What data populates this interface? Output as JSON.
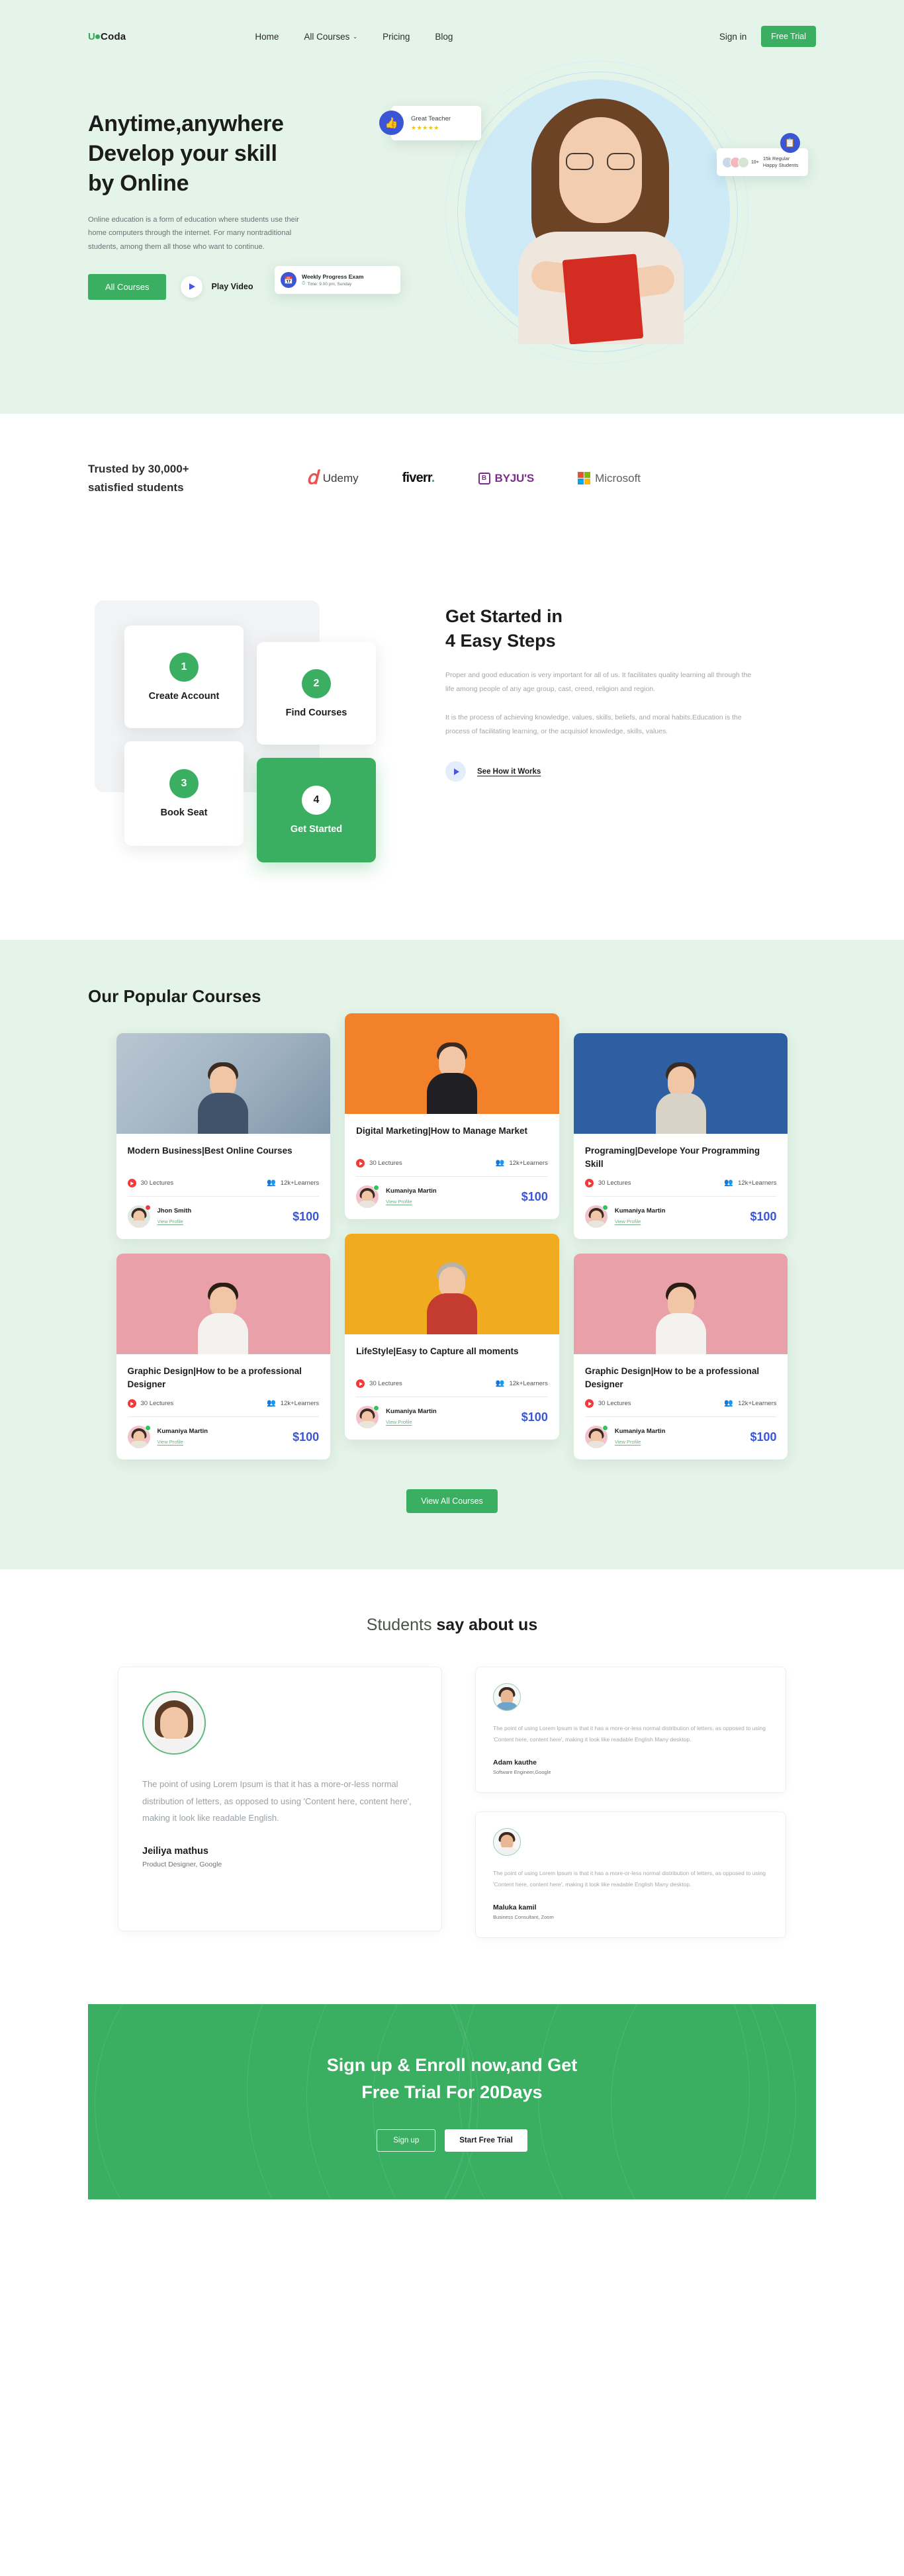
{
  "brand": {
    "logo_u": "U",
    "logo_rest": "Coda",
    "accent": "#3aaf62",
    "blue": "#3a56d4"
  },
  "nav": {
    "links": [
      {
        "label": "Home",
        "caret": ""
      },
      {
        "label": "All Courses",
        "caret": "⌄"
      },
      {
        "label": "Pricing",
        "caret": ""
      },
      {
        "label": "Blog",
        "caret": ""
      }
    ],
    "signin": "Sign in",
    "free_trial": "Free Trial"
  },
  "hero": {
    "title_line1": "Anytime,anywhere",
    "title_line2": "Develop your skill",
    "title_line3": "by Online",
    "description": "Online education is a form of education where students use their home computers through the internet. For many nontraditional students, among them all those who want to continue.",
    "btn_all_courses": "All Courses",
    "play_video": "Play Video",
    "badges": {
      "teacher": {
        "icon": "thumbs-up-icon",
        "label": "Great Teacher",
        "stars": "★★★★★"
      },
      "students": {
        "icon": "document-clock-icon",
        "more": "10+",
        "line1": "15k Regular",
        "line2": "Happy Students"
      },
      "weekly": {
        "icon": "calendar-icon",
        "title": "Weekly Progress Exam",
        "time": "Time: 9.00 pm, Sunday"
      }
    }
  },
  "trusted": {
    "title_line1": "Trusted by 30,000+",
    "title_line2": "satisfied students",
    "brands": [
      {
        "name": "Udemy",
        "mark": "udemy-logo"
      },
      {
        "name": "fiverr",
        "mark": "fiverr-logo",
        "dot": "."
      },
      {
        "name": "BYJU'S",
        "mark": "byjus-logo",
        "glyph": "Β"
      },
      {
        "name": "Microsoft",
        "mark": "microsoft-logo"
      }
    ]
  },
  "steps": {
    "cards": [
      {
        "num": "1",
        "label": "Create Account"
      },
      {
        "num": "2",
        "label": "Find Courses"
      },
      {
        "num": "3",
        "label": "Book Seat"
      },
      {
        "num": "4",
        "label": "Get Started"
      }
    ],
    "title_line1": "Get Started in",
    "title_line2": "4 Easy Steps",
    "para1": "Proper and good education is very important for all of us. It facilitates quality learning all through the life among people of any age group, cast, creed, religion and region.",
    "para2": "It is the process of achieving knowledge, values, skills, beliefs, and moral habits.Education is the process of facilitating learning, or the acquisiof knowledge, skills, values.",
    "see_how": "See How it Works"
  },
  "courses": {
    "title": "Our Popular Courses",
    "view_all": "View All Courses",
    "items": [
      {
        "name": "Modern Business|Best Online Courses",
        "lectures": "30 Lectures",
        "learners": "12k+Learners",
        "teacher": "Jhon Smith",
        "view_profile": "View Profile",
        "price": "$100",
        "thumb_class": "tb0",
        "avatar_class": "av-mint",
        "status": "dot-red"
      },
      {
        "name": "Digital Marketing|How to Manage Market",
        "lectures": "30 Lectures",
        "learners": "12k+Learners",
        "teacher": "Kumaniya Martin",
        "view_profile": "View Profile",
        "price": "$100",
        "thumb_class": "tb1",
        "avatar_class": "av-pink",
        "status": "dot-green"
      },
      {
        "name": "Programing|Develope Your Programming Skill",
        "lectures": "30 Lectures",
        "learners": "12k+Learners",
        "teacher": "Kumaniya Martin",
        "view_profile": "View Profile",
        "price": "$100",
        "thumb_class": "tb2",
        "avatar_class": "av-pink",
        "status": "dot-green"
      },
      {
        "name": "Graphic Design|How to be a professional Designer",
        "lectures": "30 Lectures",
        "learners": "12k+Learners",
        "teacher": "Kumaniya Martin",
        "view_profile": "View Profile",
        "price": "$100",
        "thumb_class": "tb3",
        "avatar_class": "av-pink",
        "status": "dot-green"
      },
      {
        "name": "LifeStyle|Easy to Capture all moments",
        "lectures": "30 Lectures",
        "learners": "12k+Learners",
        "teacher": "Kumaniya Martin",
        "view_profile": "View Profile",
        "price": "$100",
        "thumb_class": "tb4",
        "avatar_class": "av-pink",
        "status": "dot-green"
      },
      {
        "name": "Graphic Design|How to be a professional Designer",
        "lectures": "30 Lectures",
        "learners": "12k+Learners",
        "teacher": "Kumaniya Martin",
        "view_profile": "View Profile",
        "price": "$100",
        "thumb_class": "tb5",
        "avatar_class": "av-pink",
        "status": "dot-green"
      }
    ]
  },
  "testimonials": {
    "title_light": "Students ",
    "title_bold": "say about us",
    "featured": {
      "quote": "The point of using Lorem Ipsum is that it has a more-or-less normal distribution of letters, as opposed to using 'Content here, content here', making it look like readable English.",
      "name": "Jeiliya mathus",
      "role": "Product Designer, Google"
    },
    "side": [
      {
        "quote": "The point of using Lorem Ipsum is that it has a more-or-less normal distribution of letters, as opposed to using 'Content here, content here', making it look like readable English Many desktop.",
        "name": "Adam kauthe",
        "role": "Software Engineer,Google"
      },
      {
        "quote": "The point of using Lorem Ipsum is that it has a more-or-less normal distribution of letters, as opposed to using 'Content here, content here', making it look like readable English Many desktop.",
        "name": "Maluka kamil",
        "role": "Business Consultant, Zoom"
      }
    ]
  },
  "cta": {
    "title_line1": "Sign up & Enroll now,and Get",
    "title_line2": "Free Trial For 20Days",
    "btn_signup": "Sign up",
    "btn_start": "Start Free Trial"
  }
}
